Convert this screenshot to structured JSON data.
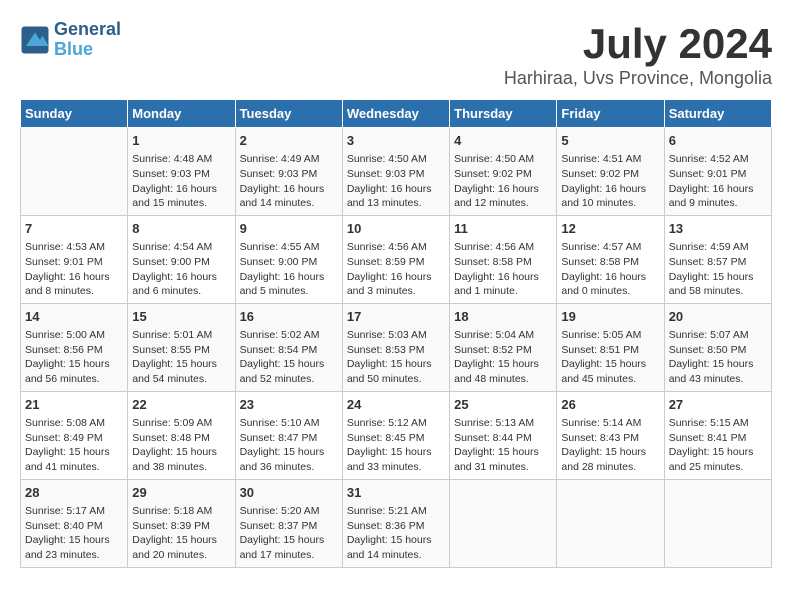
{
  "header": {
    "logo_line1": "General",
    "logo_line2": "Blue",
    "month_year": "July 2024",
    "location": "Harhiraa, Uvs Province, Mongolia"
  },
  "days_of_week": [
    "Sunday",
    "Monday",
    "Tuesday",
    "Wednesday",
    "Thursday",
    "Friday",
    "Saturday"
  ],
  "weeks": [
    [
      {
        "day": "",
        "info": ""
      },
      {
        "day": "1",
        "info": "Sunrise: 4:48 AM\nSunset: 9:03 PM\nDaylight: 16 hours\nand 15 minutes."
      },
      {
        "day": "2",
        "info": "Sunrise: 4:49 AM\nSunset: 9:03 PM\nDaylight: 16 hours\nand 14 minutes."
      },
      {
        "day": "3",
        "info": "Sunrise: 4:50 AM\nSunset: 9:03 PM\nDaylight: 16 hours\nand 13 minutes."
      },
      {
        "day": "4",
        "info": "Sunrise: 4:50 AM\nSunset: 9:02 PM\nDaylight: 16 hours\nand 12 minutes."
      },
      {
        "day": "5",
        "info": "Sunrise: 4:51 AM\nSunset: 9:02 PM\nDaylight: 16 hours\nand 10 minutes."
      },
      {
        "day": "6",
        "info": "Sunrise: 4:52 AM\nSunset: 9:01 PM\nDaylight: 16 hours\nand 9 minutes."
      }
    ],
    [
      {
        "day": "7",
        "info": "Sunrise: 4:53 AM\nSunset: 9:01 PM\nDaylight: 16 hours\nand 8 minutes."
      },
      {
        "day": "8",
        "info": "Sunrise: 4:54 AM\nSunset: 9:00 PM\nDaylight: 16 hours\nand 6 minutes."
      },
      {
        "day": "9",
        "info": "Sunrise: 4:55 AM\nSunset: 9:00 PM\nDaylight: 16 hours\nand 5 minutes."
      },
      {
        "day": "10",
        "info": "Sunrise: 4:56 AM\nSunset: 8:59 PM\nDaylight: 16 hours\nand 3 minutes."
      },
      {
        "day": "11",
        "info": "Sunrise: 4:56 AM\nSunset: 8:58 PM\nDaylight: 16 hours\nand 1 minute."
      },
      {
        "day": "12",
        "info": "Sunrise: 4:57 AM\nSunset: 8:58 PM\nDaylight: 16 hours\nand 0 minutes."
      },
      {
        "day": "13",
        "info": "Sunrise: 4:59 AM\nSunset: 8:57 PM\nDaylight: 15 hours\nand 58 minutes."
      }
    ],
    [
      {
        "day": "14",
        "info": "Sunrise: 5:00 AM\nSunset: 8:56 PM\nDaylight: 15 hours\nand 56 minutes."
      },
      {
        "day": "15",
        "info": "Sunrise: 5:01 AM\nSunset: 8:55 PM\nDaylight: 15 hours\nand 54 minutes."
      },
      {
        "day": "16",
        "info": "Sunrise: 5:02 AM\nSunset: 8:54 PM\nDaylight: 15 hours\nand 52 minutes."
      },
      {
        "day": "17",
        "info": "Sunrise: 5:03 AM\nSunset: 8:53 PM\nDaylight: 15 hours\nand 50 minutes."
      },
      {
        "day": "18",
        "info": "Sunrise: 5:04 AM\nSunset: 8:52 PM\nDaylight: 15 hours\nand 48 minutes."
      },
      {
        "day": "19",
        "info": "Sunrise: 5:05 AM\nSunset: 8:51 PM\nDaylight: 15 hours\nand 45 minutes."
      },
      {
        "day": "20",
        "info": "Sunrise: 5:07 AM\nSunset: 8:50 PM\nDaylight: 15 hours\nand 43 minutes."
      }
    ],
    [
      {
        "day": "21",
        "info": "Sunrise: 5:08 AM\nSunset: 8:49 PM\nDaylight: 15 hours\nand 41 minutes."
      },
      {
        "day": "22",
        "info": "Sunrise: 5:09 AM\nSunset: 8:48 PM\nDaylight: 15 hours\nand 38 minutes."
      },
      {
        "day": "23",
        "info": "Sunrise: 5:10 AM\nSunset: 8:47 PM\nDaylight: 15 hours\nand 36 minutes."
      },
      {
        "day": "24",
        "info": "Sunrise: 5:12 AM\nSunset: 8:45 PM\nDaylight: 15 hours\nand 33 minutes."
      },
      {
        "day": "25",
        "info": "Sunrise: 5:13 AM\nSunset: 8:44 PM\nDaylight: 15 hours\nand 31 minutes."
      },
      {
        "day": "26",
        "info": "Sunrise: 5:14 AM\nSunset: 8:43 PM\nDaylight: 15 hours\nand 28 minutes."
      },
      {
        "day": "27",
        "info": "Sunrise: 5:15 AM\nSunset: 8:41 PM\nDaylight: 15 hours\nand 25 minutes."
      }
    ],
    [
      {
        "day": "28",
        "info": "Sunrise: 5:17 AM\nSunset: 8:40 PM\nDaylight: 15 hours\nand 23 minutes."
      },
      {
        "day": "29",
        "info": "Sunrise: 5:18 AM\nSunset: 8:39 PM\nDaylight: 15 hours\nand 20 minutes."
      },
      {
        "day": "30",
        "info": "Sunrise: 5:20 AM\nSunset: 8:37 PM\nDaylight: 15 hours\nand 17 minutes."
      },
      {
        "day": "31",
        "info": "Sunrise: 5:21 AM\nSunset: 8:36 PM\nDaylight: 15 hours\nand 14 minutes."
      },
      {
        "day": "",
        "info": ""
      },
      {
        "day": "",
        "info": ""
      },
      {
        "day": "",
        "info": ""
      }
    ]
  ]
}
